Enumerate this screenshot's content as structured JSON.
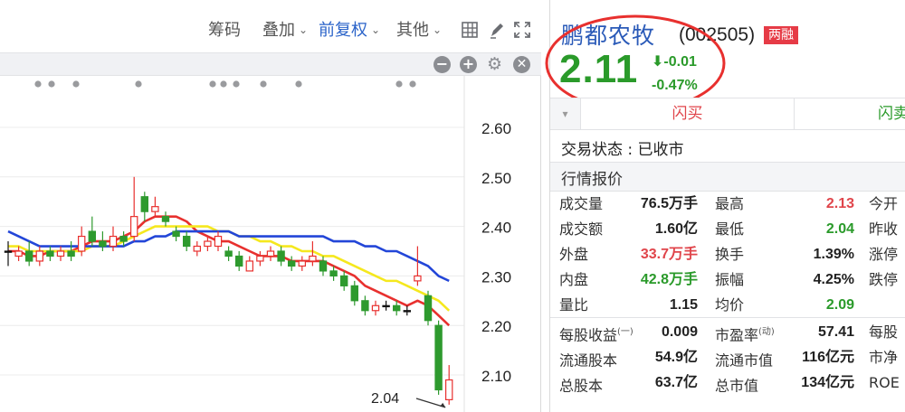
{
  "toolbar": {
    "chips_label": "筹码",
    "overlay_label": "叠加",
    "adjust_label": "前复权",
    "other_label": "其他",
    "icons": [
      "grid-icon",
      "pen-icon",
      "fullscreen-icon"
    ]
  },
  "subbar": {
    "buttons": [
      "minus",
      "plus",
      "settings",
      "close"
    ]
  },
  "chart_data": {
    "type": "candlestick",
    "y_ticks": [
      "2.60",
      "2.50",
      "2.40",
      "2.30",
      "2.20",
      "2.10"
    ],
    "ylim": [
      2.04,
      2.64
    ],
    "low_marker_label": "2.04",
    "low_marker_value": 2.04,
    "candles": [
      {
        "o": 2.35,
        "c": 2.35,
        "h": 2.37,
        "l": 2.32
      },
      {
        "o": 2.34,
        "c": 2.35,
        "h": 2.36,
        "l": 2.33
      },
      {
        "o": 2.35,
        "c": 2.33,
        "h": 2.37,
        "l": 2.32
      },
      {
        "o": 2.33,
        "c": 2.35,
        "h": 2.36,
        "l": 2.32
      },
      {
        "o": 2.35,
        "c": 2.34,
        "h": 2.36,
        "l": 2.33
      },
      {
        "o": 2.34,
        "c": 2.35,
        "h": 2.36,
        "l": 2.33
      },
      {
        "o": 2.35,
        "c": 2.34,
        "h": 2.37,
        "l": 2.33
      },
      {
        "o": 2.35,
        "c": 2.38,
        "h": 2.4,
        "l": 2.34
      },
      {
        "o": 2.39,
        "c": 2.37,
        "h": 2.42,
        "l": 2.36
      },
      {
        "o": 2.37,
        "c": 2.36,
        "h": 2.39,
        "l": 2.35
      },
      {
        "o": 2.36,
        "c": 2.38,
        "h": 2.4,
        "l": 2.35
      },
      {
        "o": 2.38,
        "c": 2.37,
        "h": 2.39,
        "l": 2.36
      },
      {
        "o": 2.38,
        "c": 2.42,
        "h": 2.5,
        "l": 2.37
      },
      {
        "o": 2.46,
        "c": 2.43,
        "h": 2.47,
        "l": 2.41
      },
      {
        "o": 2.43,
        "c": 2.44,
        "h": 2.46,
        "l": 2.42
      },
      {
        "o": 2.42,
        "c": 2.41,
        "h": 2.43,
        "l": 2.4
      },
      {
        "o": 2.39,
        "c": 2.38,
        "h": 2.4,
        "l": 2.37
      },
      {
        "o": 2.38,
        "c": 2.36,
        "h": 2.39,
        "l": 2.35
      },
      {
        "o": 2.35,
        "c": 2.36,
        "h": 2.37,
        "l": 2.34
      },
      {
        "o": 2.36,
        "c": 2.37,
        "h": 2.38,
        "l": 2.35
      },
      {
        "o": 2.36,
        "c": 2.38,
        "h": 2.39,
        "l": 2.35
      },
      {
        "o": 2.35,
        "c": 2.34,
        "h": 2.36,
        "l": 2.33
      },
      {
        "o": 2.34,
        "c": 2.32,
        "h": 2.35,
        "l": 2.31
      },
      {
        "o": 2.31,
        "c": 2.33,
        "h": 2.34,
        "l": 2.31
      },
      {
        "o": 2.33,
        "c": 2.34,
        "h": 2.35,
        "l": 2.32
      },
      {
        "o": 2.34,
        "c": 2.35,
        "h": 2.36,
        "l": 2.33
      },
      {
        "o": 2.35,
        "c": 2.33,
        "h": 2.36,
        "l": 2.32
      },
      {
        "o": 2.33,
        "c": 2.32,
        "h": 2.34,
        "l": 2.31
      },
      {
        "o": 2.32,
        "c": 2.33,
        "h": 2.34,
        "l": 2.31
      },
      {
        "o": 2.33,
        "c": 2.34,
        "h": 2.37,
        "l": 2.32
      },
      {
        "o": 2.33,
        "c": 2.31,
        "h": 2.34,
        "l": 2.3
      },
      {
        "o": 2.31,
        "c": 2.3,
        "h": 2.32,
        "l": 2.29
      },
      {
        "o": 2.3,
        "c": 2.28,
        "h": 2.31,
        "l": 2.27
      },
      {
        "o": 2.28,
        "c": 2.25,
        "h": 2.29,
        "l": 2.24
      },
      {
        "o": 2.25,
        "c": 2.23,
        "h": 2.26,
        "l": 2.22
      },
      {
        "o": 2.23,
        "c": 2.24,
        "h": 2.25,
        "l": 2.22
      },
      {
        "o": 2.24,
        "c": 2.24,
        "h": 2.25,
        "l": 2.23
      },
      {
        "o": 2.24,
        "c": 2.23,
        "h": 2.25,
        "l": 2.22
      },
      {
        "o": 2.23,
        "c": 2.23,
        "h": 2.24,
        "l": 2.22
      },
      {
        "o": 2.29,
        "c": 2.3,
        "h": 2.36,
        "l": 2.28
      },
      {
        "o": 2.26,
        "c": 2.21,
        "h": 2.27,
        "l": 2.2
      },
      {
        "o": 2.2,
        "c": 2.07,
        "h": 2.21,
        "l": 2.06
      },
      {
        "o": 2.05,
        "c": 2.09,
        "h": 2.12,
        "l": 2.04
      }
    ],
    "ma_lines": [
      {
        "name": "MA5",
        "color": "#e8302e",
        "values": [
          2.35,
          2.35,
          2.34,
          2.34,
          2.35,
          2.35,
          2.35,
          2.36,
          2.37,
          2.37,
          2.37,
          2.38,
          2.39,
          2.41,
          2.42,
          2.42,
          2.42,
          2.41,
          2.39,
          2.38,
          2.37,
          2.37,
          2.36,
          2.35,
          2.34,
          2.34,
          2.34,
          2.33,
          2.33,
          2.33,
          2.33,
          2.32,
          2.31,
          2.3,
          2.28,
          2.27,
          2.26,
          2.25,
          2.24,
          2.25,
          2.24,
          2.22,
          2.2
        ]
      },
      {
        "name": "MA10",
        "color": "#f5e81e",
        "values": [
          2.36,
          2.36,
          2.35,
          2.35,
          2.35,
          2.35,
          2.35,
          2.35,
          2.36,
          2.36,
          2.36,
          2.37,
          2.38,
          2.39,
          2.4,
          2.4,
          2.4,
          2.4,
          2.4,
          2.4,
          2.39,
          2.39,
          2.38,
          2.38,
          2.37,
          2.37,
          2.36,
          2.36,
          2.35,
          2.35,
          2.34,
          2.34,
          2.33,
          2.32,
          2.31,
          2.3,
          2.29,
          2.29,
          2.28,
          2.27,
          2.26,
          2.25,
          2.23
        ]
      },
      {
        "name": "MA20",
        "color": "#2346d8",
        "values": [
          2.39,
          2.38,
          2.37,
          2.36,
          2.36,
          2.36,
          2.36,
          2.36,
          2.36,
          2.36,
          2.36,
          2.36,
          2.37,
          2.37,
          2.38,
          2.38,
          2.39,
          2.39,
          2.39,
          2.39,
          2.39,
          2.39,
          2.38,
          2.38,
          2.38,
          2.38,
          2.38,
          2.38,
          2.38,
          2.38,
          2.38,
          2.37,
          2.37,
          2.37,
          2.36,
          2.36,
          2.35,
          2.35,
          2.34,
          2.33,
          2.32,
          2.3,
          2.29
        ]
      }
    ]
  },
  "quote": {
    "name": "鹏都农牧",
    "code": "(002505)",
    "badge": "两融",
    "price": "2.11",
    "change": "-0.01",
    "change_pct": "-0.47%",
    "buy_label": "闪买",
    "sell_label": "闪卖",
    "status_text": "交易状态 : 已收市",
    "section_title": "行情报价",
    "rows": [
      {
        "l1": "成交量",
        "v1": "76.5万手",
        "c1": "",
        "l2": "最高",
        "v2": "2.13",
        "c2": "red",
        "l3": "今开"
      },
      {
        "l1": "成交额",
        "v1": "1.60亿",
        "c1": "",
        "l2": "最低",
        "v2": "2.04",
        "c2": "green",
        "l3": "昨收"
      },
      {
        "l1": "外盘",
        "v1": "33.7万手",
        "c1": "red",
        "l2": "换手",
        "v2": "1.39%",
        "c2": "",
        "l3": "涨停"
      },
      {
        "l1": "内盘",
        "v1": "42.8万手",
        "c1": "green",
        "l2": "振幅",
        "v2": "4.25%",
        "c2": "",
        "l3": "跌停"
      },
      {
        "l1": "量比",
        "v1": "1.15",
        "c1": "",
        "l2": "均价",
        "v2": "2.09",
        "c2": "green",
        "l3": ""
      }
    ],
    "fin_rows": [
      {
        "l1": "每股收益",
        "sup1": "(一)",
        "v1": "0.009",
        "l2": "市盈率",
        "sup2": "(动)",
        "v2": "57.41",
        "l3": "每股"
      },
      {
        "l1": "流通股本",
        "sup1": "",
        "v1": "54.9亿",
        "l2": "流通市值",
        "sup2": "",
        "v2": "116亿元",
        "l3": "市净"
      },
      {
        "l1": "总股本",
        "sup1": "",
        "v1": "63.7亿",
        "l2": "总市值",
        "sup2": "",
        "v2": "134亿元",
        "l3": "ROE"
      }
    ]
  }
}
